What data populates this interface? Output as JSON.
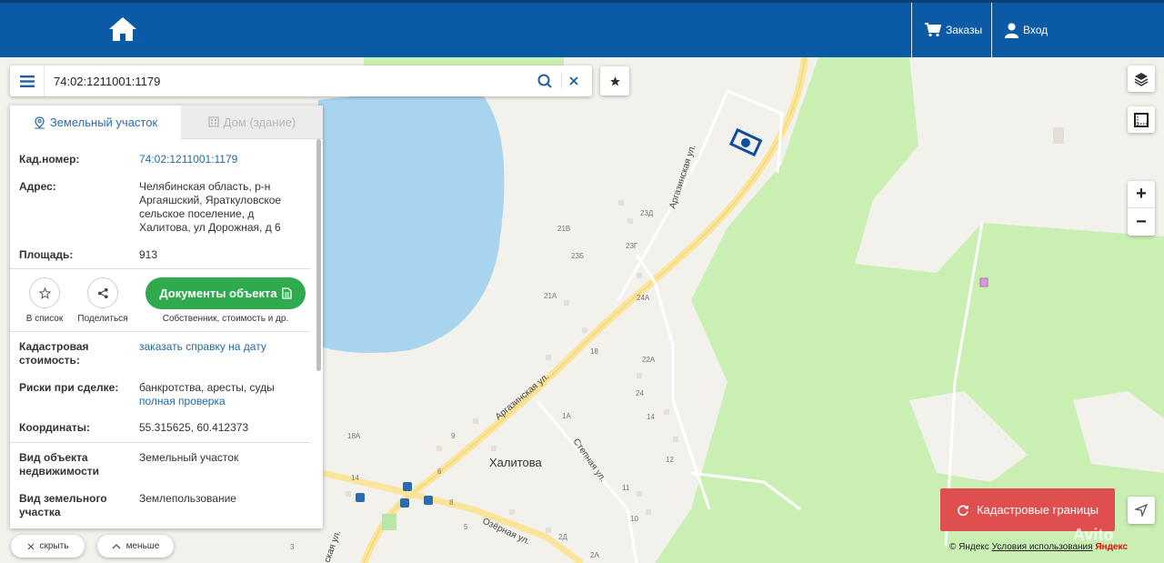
{
  "header": {
    "orders_label": "Заказы",
    "login_label": "Вход"
  },
  "search": {
    "value": "74:02:1211001:1179"
  },
  "tabs": {
    "land": "Земельный участок",
    "house": "Дом (здание)"
  },
  "details": {
    "cadnum_label": "Кад.номер:",
    "cadnum_value": "74:02:1211001:1179",
    "address_label": "Адрес:",
    "address_lines": [
      "Челябинская область, р-н",
      "Аргаяшский, Яраткуловское",
      "сельское поселение, д",
      "Халитова, ул Дорожная, д 6"
    ],
    "area_label": "Площадь:",
    "area_value": "913",
    "cad_cost_label_lines": [
      "Кадастровая",
      "стоимость:"
    ],
    "cad_cost_link": "заказать справку на дату",
    "risks_label": "Риски при сделке:",
    "risks_value": "банкротства, аресты, суды",
    "risks_link": "полная проверка",
    "coords_label": "Координаты:",
    "coords_value": "55.315625, 60.412373",
    "obj_type_label_lines": [
      "Вид объекта",
      "недвижимости"
    ],
    "obj_type_value": "Земельный участок",
    "land_type_label_lines": [
      "Вид земельного",
      "участка"
    ],
    "land_type_value": "Землепользование"
  },
  "actions": {
    "list_label": "В список",
    "share_label": "Поделиться",
    "docs_label": "Документы объекта",
    "docs_sub": "Собственник, стоимость и др."
  },
  "bottom": {
    "hide_label": "скрыть",
    "less_label": "меньше"
  },
  "map": {
    "cadastral_button": "Кадастровые границы",
    "attribution_prefix": "© Яндекс",
    "terms_link": "Условия использования",
    "yandex_logo": "Яндекс",
    "watermark": "Avito",
    "village_name": "Халитова",
    "streets": [
      "Аргазинская ул.",
      "Аргазинская ул.",
      "Степная ул.",
      "Озёрная ул.",
      "ская ул."
    ],
    "house_numbers": [
      "23Д",
      "21В",
      "23Г",
      "23Б",
      "21А",
      "24А",
      "18",
      "22А",
      "24",
      "14",
      "1А",
      "12",
      "11",
      "10",
      "9",
      "6",
      "8",
      "5",
      "2Д",
      "2А",
      "18А",
      "14",
      "3"
    ]
  },
  "colors": {
    "header": "#0a5aa5",
    "docs_button": "#2fab4d",
    "cadastral_button": "#df4f4f",
    "link": "#1f6aa8"
  }
}
